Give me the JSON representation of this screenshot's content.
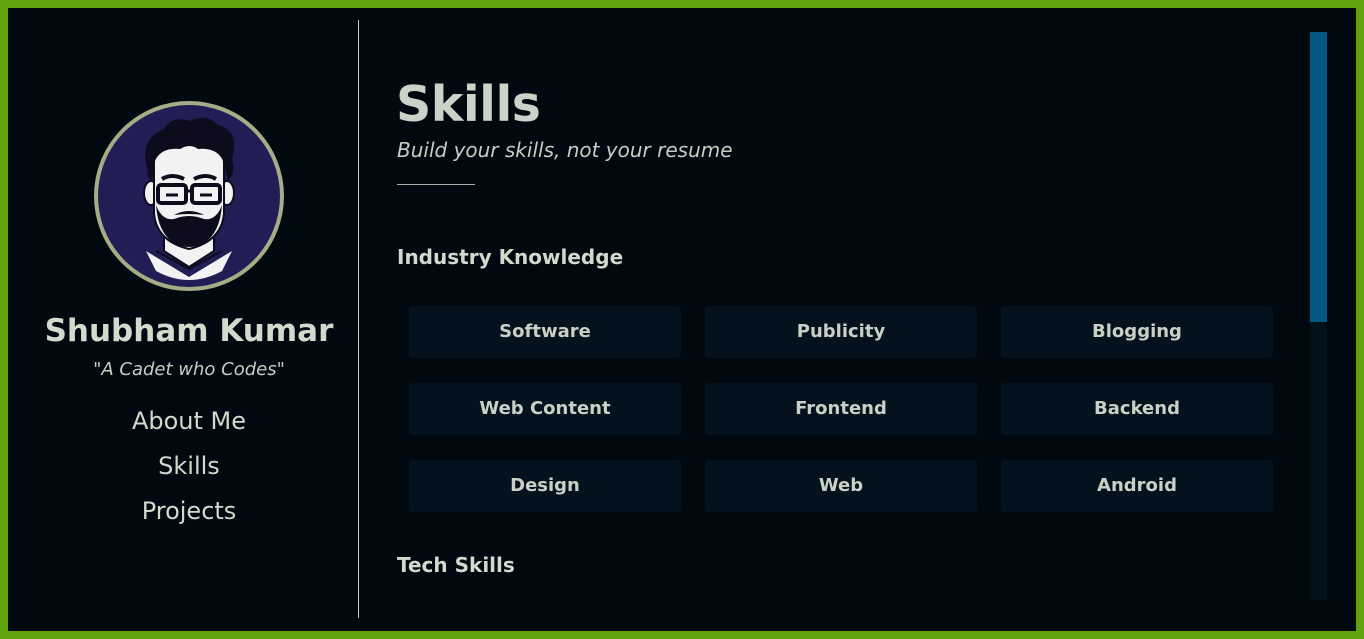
{
  "profile": {
    "name": "Shubham Kumar",
    "tagline": "\"A Cadet who Codes\"",
    "avatar_icon": "bearded-man-with-glasses-avatar"
  },
  "nav": {
    "items": [
      {
        "label": "About Me"
      },
      {
        "label": "Skills"
      },
      {
        "label": "Projects"
      }
    ]
  },
  "page": {
    "title": "Skills",
    "subtitle": "Build your skills, not your resume"
  },
  "sections": {
    "industry": {
      "heading": "Industry Knowledge",
      "items": [
        "Software",
        "Publicity",
        "Blogging",
        "Web Content",
        "Frontend",
        "Backend",
        "Design",
        "Web",
        "Android"
      ]
    },
    "tech": {
      "heading": "Tech Skills"
    }
  },
  "colors": {
    "frame_border": "#5fa30e",
    "background": "#010910",
    "chip_background": "#03121c",
    "scroll_thumb": "#055680",
    "avatar_ring": "#a6ad86",
    "avatar_fill": "#221d55"
  }
}
